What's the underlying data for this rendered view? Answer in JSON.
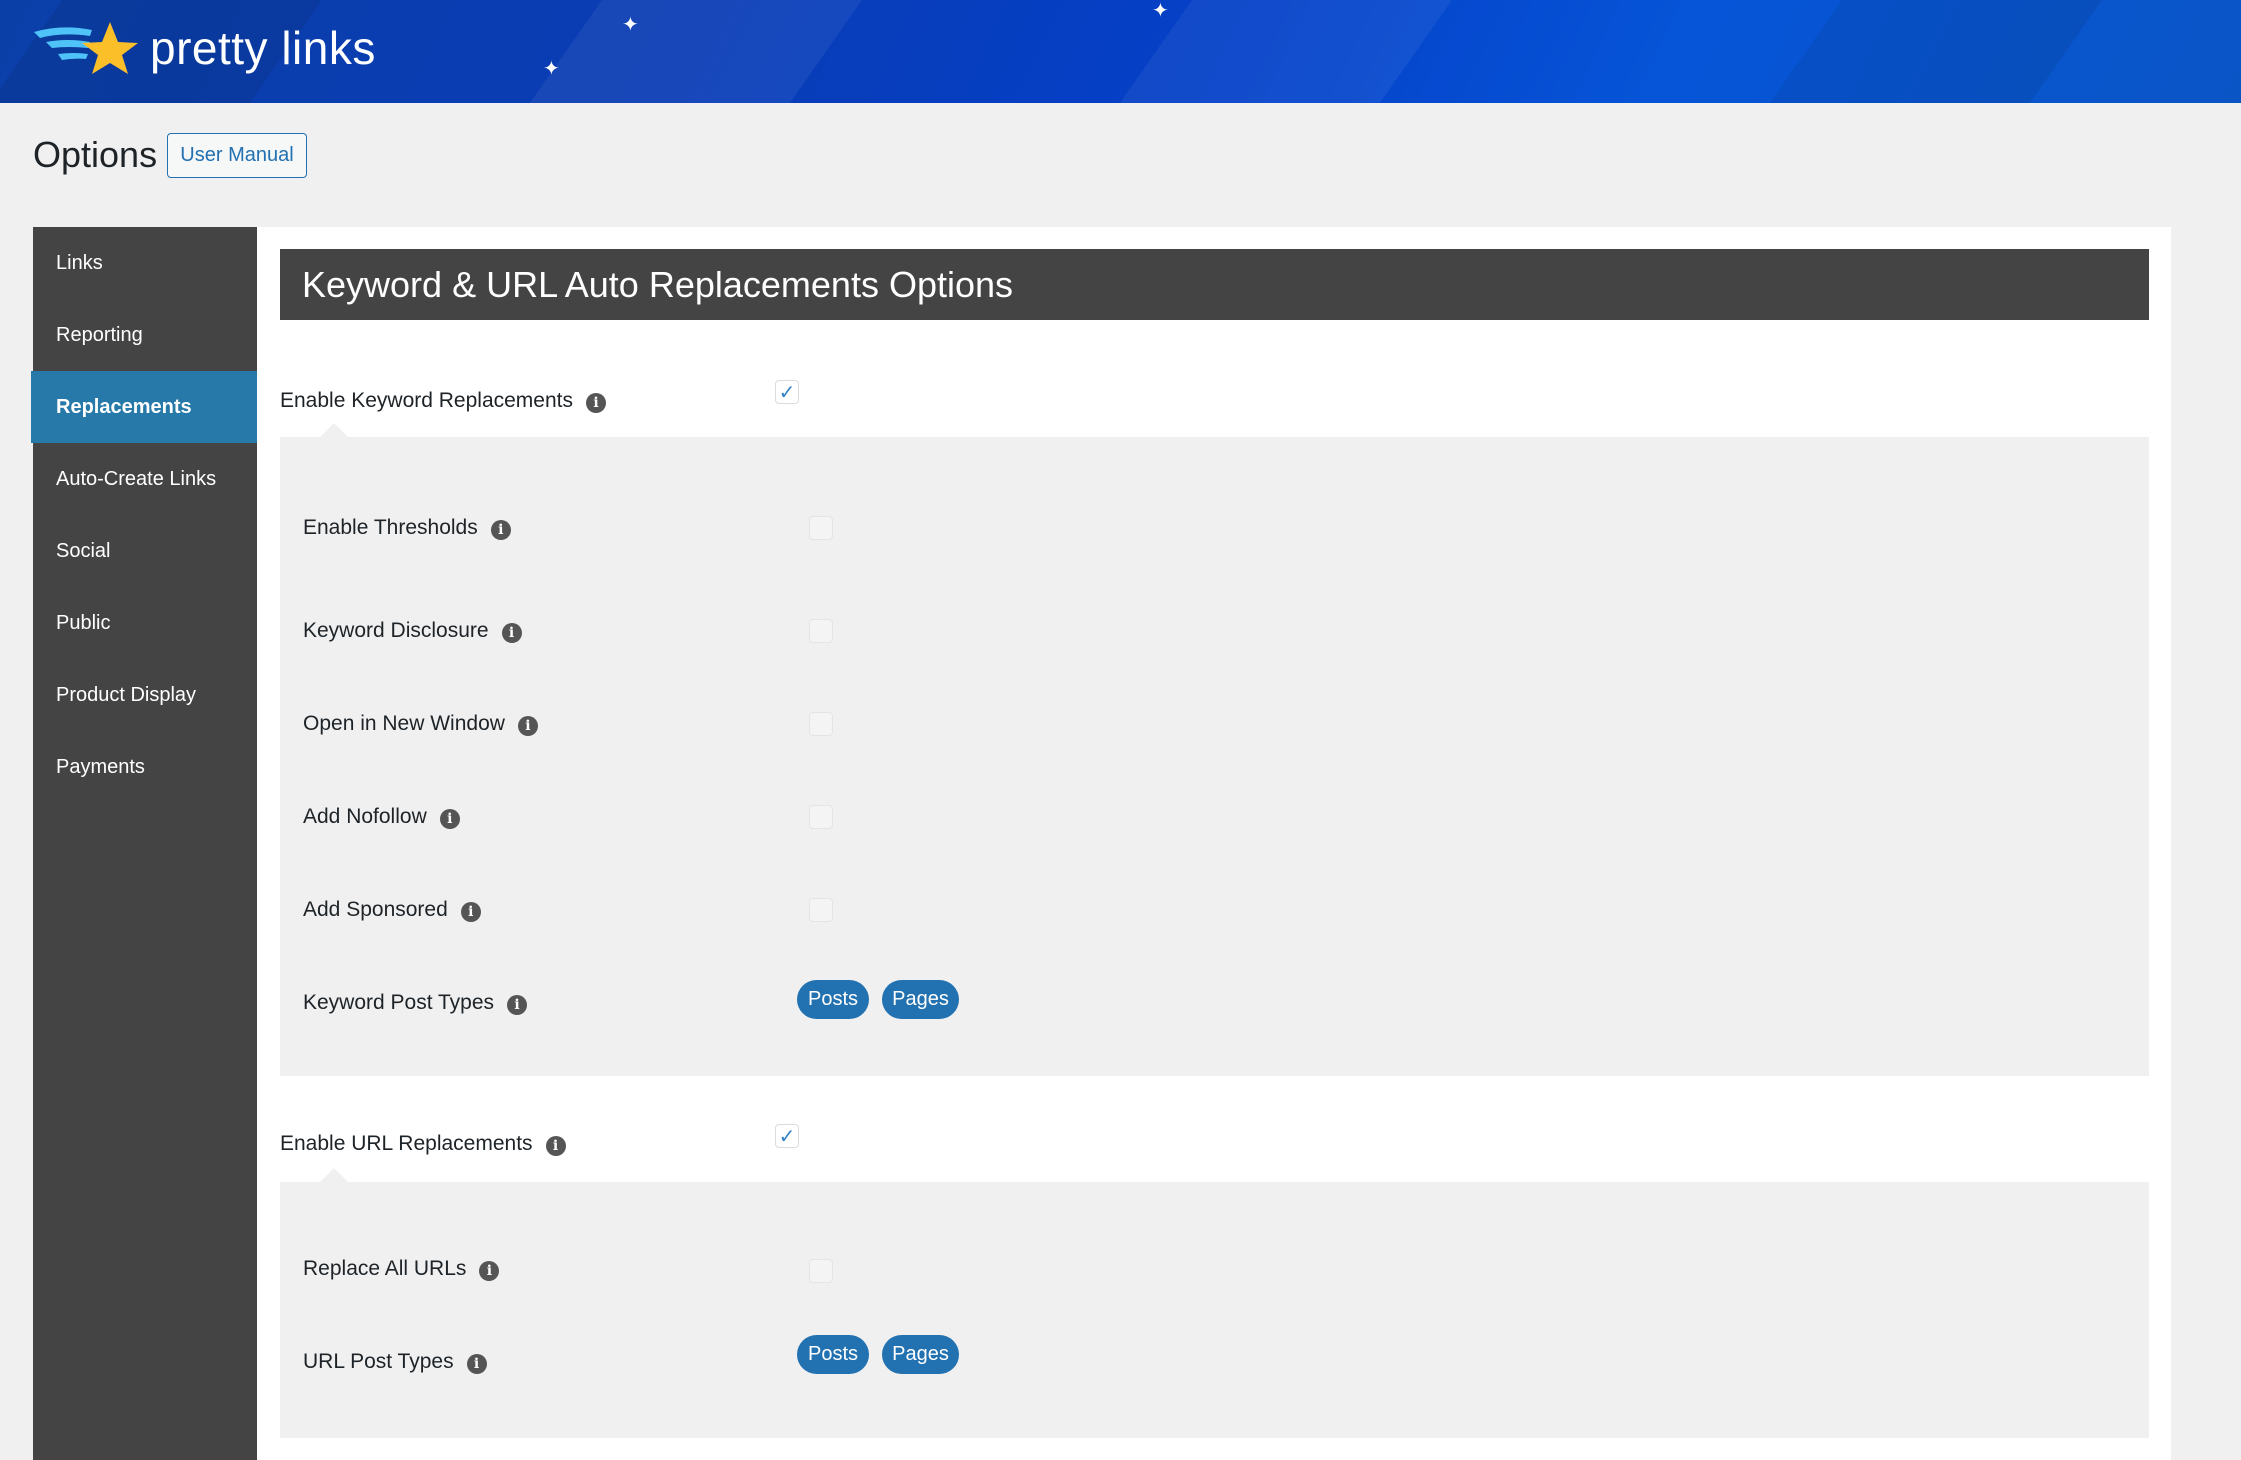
{
  "brand": {
    "name": "pretty links"
  },
  "page": {
    "title": "Options",
    "manual_button": "User Manual"
  },
  "sidebar": {
    "items": [
      {
        "label": "Links"
      },
      {
        "label": "Reporting"
      },
      {
        "label": "Replacements",
        "active": true
      },
      {
        "label": "Auto-Create Links"
      },
      {
        "label": "Social"
      },
      {
        "label": "Public"
      },
      {
        "label": "Product Display"
      },
      {
        "label": "Payments"
      }
    ]
  },
  "section": {
    "title": "Keyword & URL Auto Replacements Options"
  },
  "keyword": {
    "label": "Enable Keyword Replacements",
    "checked": true,
    "options": [
      {
        "label": "Enable Thresholds",
        "checked": false
      },
      {
        "label": "Keyword Disclosure",
        "checked": false
      },
      {
        "label": "Open in New Window",
        "checked": false
      },
      {
        "label": "Add Nofollow",
        "checked": false
      },
      {
        "label": "Add Sponsored",
        "checked": false
      }
    ],
    "post_types_label": "Keyword Post Types",
    "post_types": [
      "Posts",
      "Pages"
    ]
  },
  "url": {
    "label": "Enable URL Replacements",
    "checked": true,
    "options": [
      {
        "label": "Replace All URLs",
        "checked": false
      }
    ],
    "post_types_label": "URL Post Types",
    "post_types": [
      "Posts",
      "Pages"
    ]
  },
  "icons": {
    "info": "i",
    "check": "✓"
  }
}
